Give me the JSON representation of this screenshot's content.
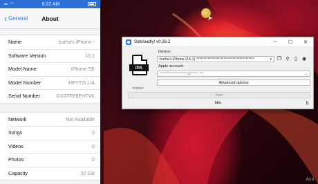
{
  "phone": {
    "status": {
      "time": "8:22 AM"
    },
    "nav": {
      "back_label": "General",
      "title": "About"
    },
    "groups": [
      [
        {
          "label": "Name",
          "value": "burha's iPhone",
          "chevron": true
        },
        {
          "label": "Software Version",
          "value": "15.1"
        },
        {
          "label": "Model Name",
          "value": "iPhone SE"
        },
        {
          "label": "Model Number",
          "value": "MP7T2LL/A"
        },
        {
          "label": "Serial Number",
          "value": "DX3TFE8FHTVK"
        }
      ],
      [
        {
          "label": "Network",
          "value": "Not Available"
        },
        {
          "label": "Songs",
          "value": "0"
        },
        {
          "label": "Videos",
          "value": "0"
        },
        {
          "label": "Photos",
          "value": "0"
        },
        {
          "label": "Capacity",
          "value": "32 GB"
        }
      ]
    ]
  },
  "sideloadly": {
    "title": "Sideloadly! v0.26.2",
    "controls": {
      "minimize": "─",
      "maximize": "☐",
      "close": "✕"
    },
    "ipa_label": "IPA",
    "ipa_caption": "<none>",
    "device_label": "Device:",
    "device_value": "burha's iPhone (15.1) ****************************************",
    "apple_account_label": "Apple account:",
    "apple_account_value": "*******************@*****.***",
    "advanced_label": "Advanced options",
    "start_label": "Start",
    "status": "Idle."
  },
  "watermark": "Acti",
  "colors": {
    "ios_blue": "#2f7bf6",
    "status_bar": "#2d6fd6"
  }
}
